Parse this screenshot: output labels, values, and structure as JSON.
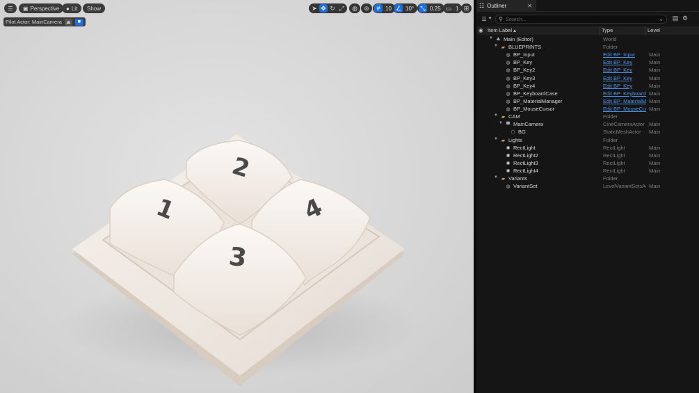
{
  "viewport": {
    "view_mode_label": "Perspective",
    "lighting_label": "Lit",
    "show_label": "Show",
    "grid_value": "10",
    "angle_value": "10°",
    "scale_value": "0.25",
    "camera_speed_value": "1",
    "pilot_label": "Pilot Actor: MainCamera",
    "keys": [
      "1",
      "2",
      "3",
      "4"
    ]
  },
  "outliner": {
    "tab_title": "Outliner",
    "search_placeholder": "Search...",
    "columns": {
      "item_label": "Item Label ▴",
      "type": "Type",
      "level": "Level"
    },
    "rows": [
      {
        "label": "Main (Editor)",
        "type": "World",
        "level": "",
        "icon": "world-icon"
      },
      {
        "label": "BLUEPRINTS",
        "type": "Folder",
        "level": "",
        "icon": "folder-icon"
      },
      {
        "label": "BP_Input",
        "type": "Edit BP_Input",
        "level": "Main",
        "icon": "blueprint-icon",
        "link": true
      },
      {
        "label": "BP_Key",
        "type": "Edit BP_Key",
        "level": "Main",
        "icon": "blueprint-icon",
        "link": true
      },
      {
        "label": "BP_Key2",
        "type": "Edit BP_Key",
        "level": "Main",
        "icon": "blueprint-icon",
        "link": true
      },
      {
        "label": "BP_Key3",
        "type": "Edit BP_Key",
        "level": "Main",
        "icon": "blueprint-icon",
        "link": true
      },
      {
        "label": "BP_Key4",
        "type": "Edit BP_Key",
        "level": "Main",
        "icon": "blueprint-icon",
        "link": true
      },
      {
        "label": "BP_KeyboardCase",
        "type": "Edit BP_KeyboardC",
        "level": "Main",
        "icon": "blueprint-icon",
        "link": true
      },
      {
        "label": "BP_MaterialManager",
        "type": "Edit BP_MaterialMa",
        "level": "Main",
        "icon": "blueprint-icon",
        "link": true
      },
      {
        "label": "BP_MouseCursor",
        "type": "Edit BP_MouseCurs",
        "level": "Main",
        "icon": "blueprint-icon",
        "link": true
      },
      {
        "label": "CAM",
        "type": "Folder",
        "level": "",
        "icon": "folder-icon"
      },
      {
        "label": "MainCamera",
        "type": "CineCameraActor",
        "level": "Main",
        "icon": "camera-icon"
      },
      {
        "label": "BG",
        "type": "StaticMeshActor",
        "level": "Main",
        "icon": "mesh-icon"
      },
      {
        "label": "Lights",
        "type": "Folder",
        "level": "",
        "icon": "folder-icon"
      },
      {
        "label": "RectLight",
        "type": "RectLight",
        "level": "Main",
        "icon": "light-icon"
      },
      {
        "label": "RectLight2",
        "type": "RectLight",
        "level": "Main",
        "icon": "light-icon"
      },
      {
        "label": "RectLight3",
        "type": "RectLight",
        "level": "Main",
        "icon": "light-icon"
      },
      {
        "label": "RectLight4",
        "type": "RectLight",
        "level": "Main",
        "icon": "light-icon"
      },
      {
        "label": "Variants",
        "type": "Folder",
        "level": "",
        "icon": "folder-icon"
      },
      {
        "label": "VariantSet",
        "type": "LevelVariantSetsAc",
        "level": "Main",
        "icon": "variant-icon"
      }
    ]
  },
  "colors": {
    "accent": "#1e6fd9",
    "link": "#4d95e8",
    "folder": "#c59a45"
  }
}
